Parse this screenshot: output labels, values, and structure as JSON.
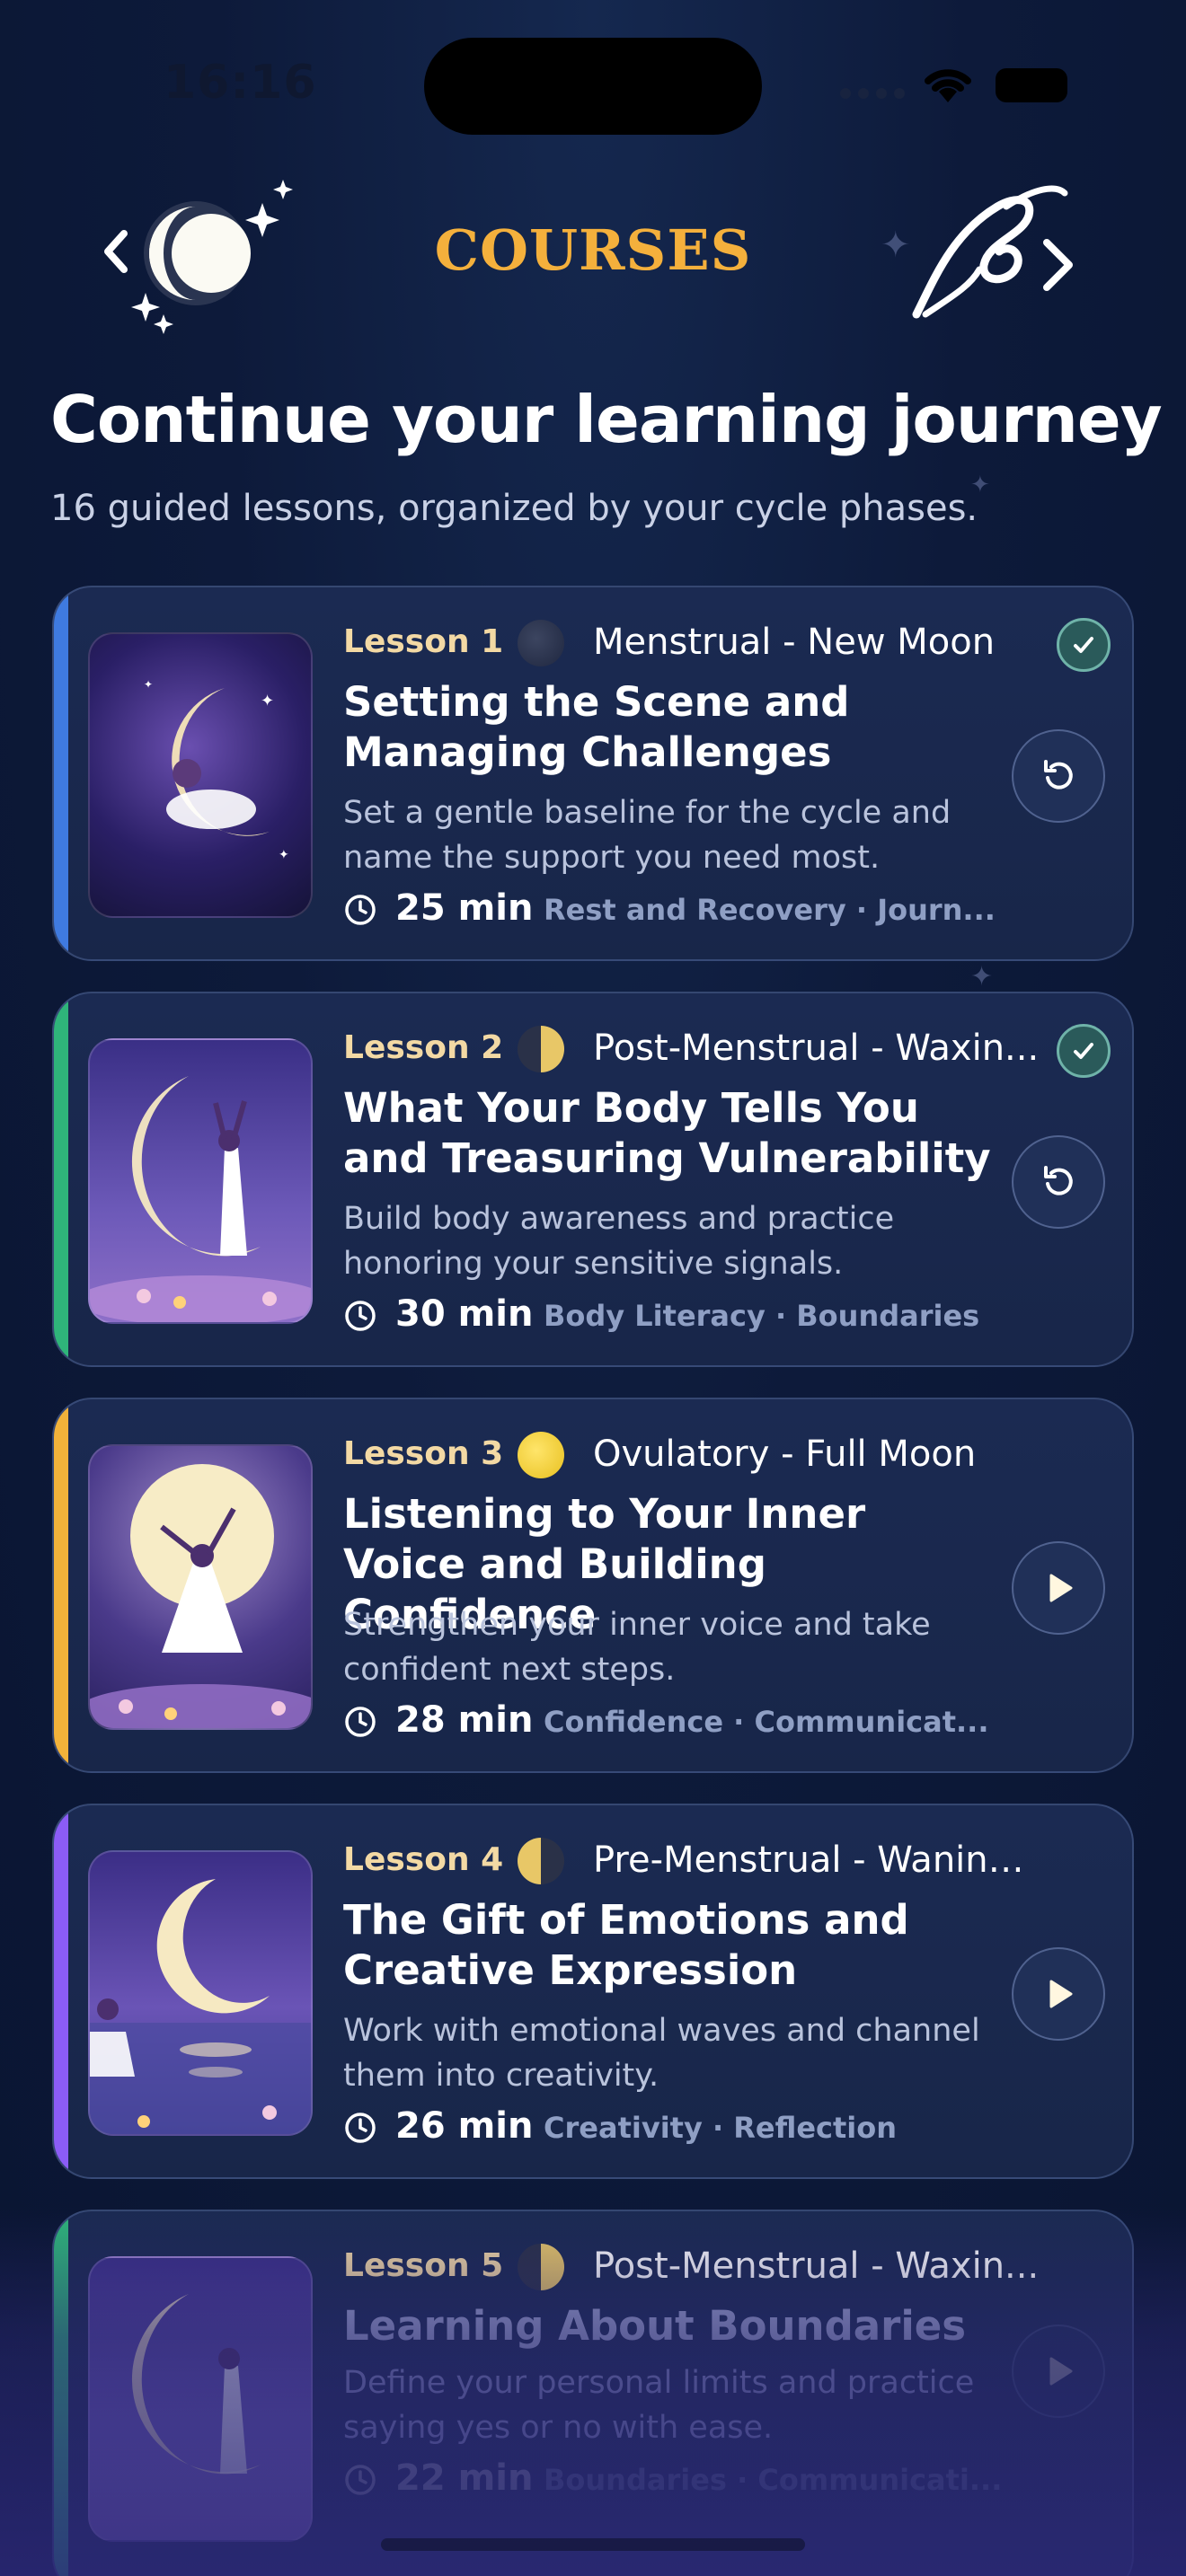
{
  "status_bar": {
    "time": "16:16"
  },
  "header": {
    "title": "COURSES"
  },
  "page": {
    "title": "Continue your learning journey",
    "subtitle": "16 guided lessons, organized by your cycle phases."
  },
  "colors": {
    "accent_title": "#f4b03c",
    "lesson_label": "#f3d9a4",
    "bar_blue": "#3f7ae0",
    "bar_green": "#2fb47a",
    "bar_yellow": "#f2b23a",
    "bar_purple": "#8b5cf6"
  },
  "lessons": [
    {
      "label": "Lesson 1",
      "phase": "Menstrual - New Moon",
      "moon_icon": "new-moon-icon",
      "title": "Setting the Scene and Managing Challenges",
      "description": "Set a gentle baseline for the cycle and name the support you need most.",
      "duration": "25 min",
      "tags": "Rest and Recovery · Journ...",
      "completed": true,
      "action": "restart-icon"
    },
    {
      "label": "Lesson 2",
      "phase": "Post-Menstrual - Waxin...",
      "moon_icon": "waxing-moon-icon",
      "title": "What Your Body Tells You and Treasuring Vulnerability",
      "description": "Build body awareness and practice honoring your sensitive signals.",
      "duration": "30 min",
      "tags": "Body Literacy · Boundaries",
      "completed": true,
      "action": "restart-icon"
    },
    {
      "label": "Lesson 3",
      "phase": "Ovulatory - Full Moon",
      "moon_icon": "full-moon-icon",
      "title": "Listening to Your Inner Voice and Building Confidence",
      "description": "Strengthen your inner voice and take confident next steps.",
      "duration": "28 min",
      "tags": "Confidence · Communicat...",
      "completed": false,
      "action": "play-icon"
    },
    {
      "label": "Lesson 4",
      "phase": "Pre-Menstrual - Waning...",
      "moon_icon": "waning-moon-icon",
      "title": "The Gift of Emotions and Creative Expression",
      "description": "Work with emotional waves and channel them into creativity.",
      "duration": "26 min",
      "tags": "Creativity · Reflection",
      "completed": false,
      "action": "play-icon"
    },
    {
      "label": "Lesson 5",
      "phase": "Post-Menstrual - Waxin...",
      "moon_icon": "waxing-moon-icon",
      "title": "Learning About Boundaries",
      "description": "Define your personal limits and practice saying yes or no with ease.",
      "duration": "22 min",
      "tags": "Boundaries · Communicati...",
      "completed": false,
      "action": "play-icon"
    }
  ]
}
